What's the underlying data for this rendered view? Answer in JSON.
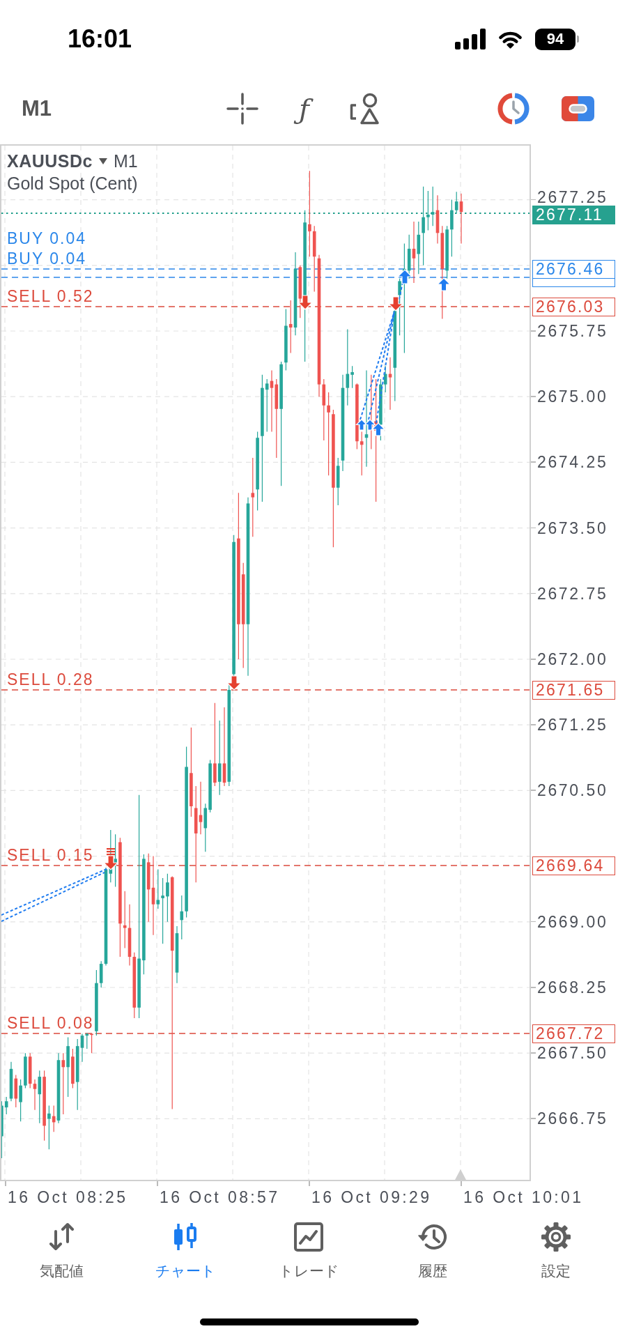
{
  "status_bar": {
    "time": "16:01",
    "battery": "94"
  },
  "toolbar": {
    "timeframe": "M1",
    "indicator_glyph": "ƒ"
  },
  "chart": {
    "symbol": "XAUUSDc",
    "timeframe": "M1",
    "description": "Gold Spot (Cent)",
    "current_price": "2677.11",
    "orders": [
      {
        "kind": "buy",
        "label": "BUY 0.04",
        "price_tag": "2676.46",
        "price_tag_covered": false
      },
      {
        "kind": "buy",
        "label": "BUY 0.04",
        "price_tag_covered": true
      },
      {
        "kind": "sell",
        "label": "SELL 0.52",
        "price_tag": "2676.03",
        "price_tag_covered": false
      },
      {
        "kind": "sell",
        "label": "SELL 0.28",
        "price_tag": "2671.65",
        "price_tag_covered": false
      },
      {
        "kind": "sell",
        "label": "SELL 0.15",
        "price_tag": "2669.64",
        "price_tag_covered": false
      },
      {
        "kind": "sell",
        "label": "SELL 0.08",
        "price_tag": "2667.72",
        "price_tag_covered": false
      }
    ],
    "price_axis": [
      "2677.25",
      "2675.75",
      "2675.00",
      "2674.25",
      "2673.50",
      "2672.75",
      "2672.00",
      "2671.25",
      "2670.50",
      "2669.00",
      "2668.25",
      "2667.50",
      "2666.75"
    ],
    "time_axis": [
      "16 Oct 08:25",
      "16 Oct 08:57",
      "16 Oct 09:29",
      "16 Oct 10:01"
    ]
  },
  "tabs": [
    {
      "label": "気配値",
      "selected": false
    },
    {
      "label": "チャート",
      "selected": true
    },
    {
      "label": "トレード",
      "selected": false
    },
    {
      "label": "履歴",
      "selected": false
    },
    {
      "label": "設定",
      "selected": false
    }
  ]
}
